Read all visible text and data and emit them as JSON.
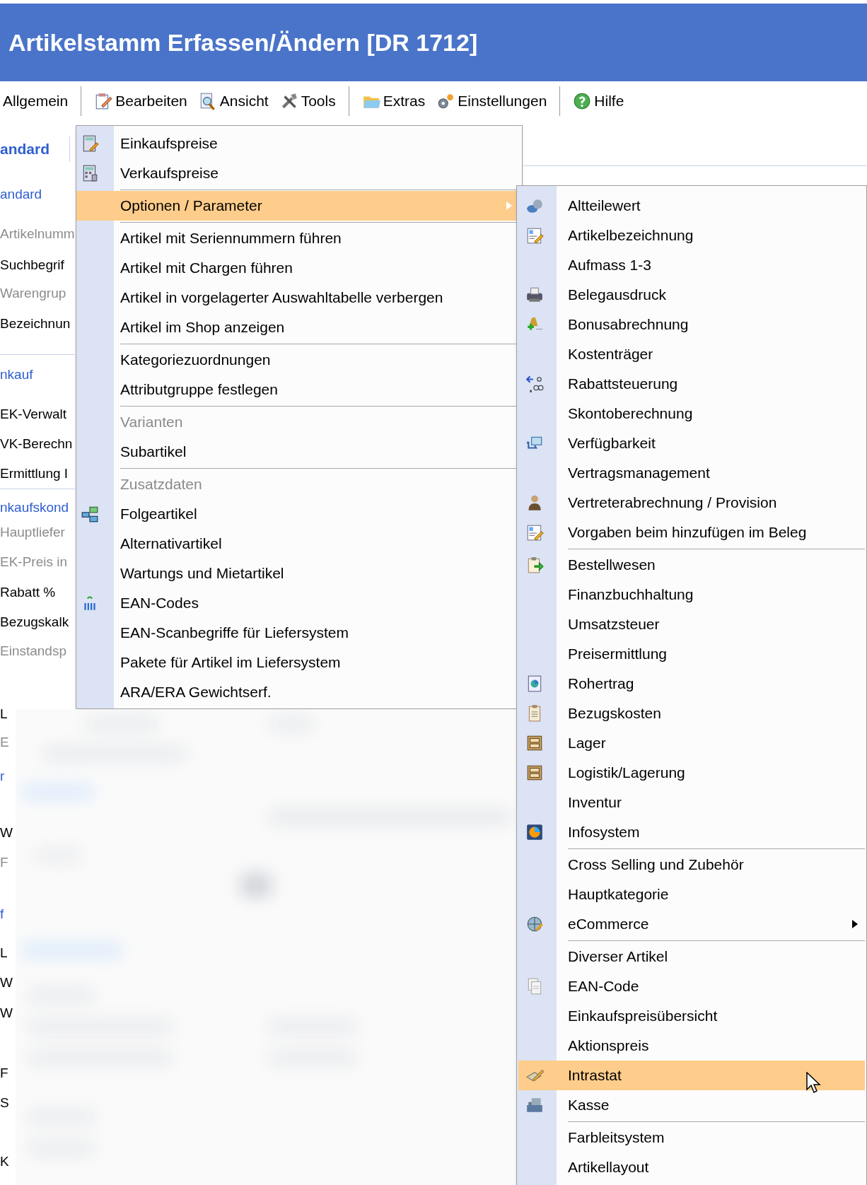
{
  "window": {
    "title": "Artikelstamm Erfassen/Ändern [DR 1712]"
  },
  "toolbar": [
    {
      "kind": "button",
      "label": "Allgemein"
    },
    {
      "kind": "separator"
    },
    {
      "kind": "button",
      "label": "Bearbeiten"
    },
    {
      "kind": "button",
      "label": "Ansicht"
    },
    {
      "kind": "button",
      "label": "Tools"
    },
    {
      "kind": "separator"
    },
    {
      "kind": "button",
      "label": "Extras"
    },
    {
      "kind": "button",
      "label": "Einstellungen"
    },
    {
      "kind": "separator"
    },
    {
      "kind": "button",
      "label": "Hilfe"
    }
  ],
  "form_fragments": [
    {
      "kind": "tab",
      "text": "andard"
    },
    {
      "kind": "section",
      "text": "andard"
    },
    {
      "kind": "disabled",
      "text": "Artikelnumm"
    },
    {
      "kind": "label",
      "text": "Suchbegrif"
    },
    {
      "kind": "disabled",
      "text": "Warengrup"
    },
    {
      "kind": "label",
      "text": "Bezeichnun"
    },
    {
      "kind": "section",
      "text": "nkauf"
    },
    {
      "kind": "label",
      "text": "EK-Verwalt"
    },
    {
      "kind": "label",
      "text": "VK-Berechn"
    },
    {
      "kind": "label",
      "text": "Ermittlung I"
    },
    {
      "kind": "section",
      "text": "nkaufskond"
    },
    {
      "kind": "disabled",
      "text": "Hauptliefer"
    },
    {
      "kind": "disabled",
      "text": "EK-Preis in"
    },
    {
      "kind": "label",
      "text": "Rabatt %"
    },
    {
      "kind": "label",
      "text": "Bezugskalk"
    },
    {
      "kind": "disabled",
      "text": "Einstandsp"
    }
  ],
  "lower_fragments": [
    {
      "kind": "label",
      "text": "L"
    },
    {
      "kind": "disabled",
      "text": "E"
    },
    {
      "kind": "section",
      "text": "r"
    },
    {
      "kind": "label",
      "text": "W"
    },
    {
      "kind": "disabled",
      "text": "F"
    },
    {
      "kind": "section",
      "text": "f"
    },
    {
      "kind": "label",
      "text": "L"
    },
    {
      "kind": "label",
      "text": "W"
    },
    {
      "kind": "label",
      "text": "W"
    },
    {
      "kind": "label",
      "text": "F"
    },
    {
      "kind": "label",
      "text": "S"
    },
    {
      "kind": "label",
      "text": "K"
    }
  ],
  "menu": [
    {
      "kind": "item",
      "label": "Einkaufspreise",
      "disabled": false,
      "selected": false
    },
    {
      "kind": "item",
      "label": "Verkaufspreise",
      "disabled": false,
      "selected": false
    },
    {
      "kind": "separator"
    },
    {
      "kind": "submenu",
      "label": "Optionen / Parameter",
      "disabled": false,
      "selected": true
    },
    {
      "kind": "separator"
    },
    {
      "kind": "item",
      "label": "Artikel mit Seriennummern führen",
      "disabled": false,
      "selected": false
    },
    {
      "kind": "item",
      "label": "Artikel mit Chargen führen",
      "disabled": false,
      "selected": false
    },
    {
      "kind": "item",
      "label": "Artikel in vorgelagerter Auswahltabelle verbergen",
      "disabled": false,
      "selected": false
    },
    {
      "kind": "item",
      "label": "Artikel im Shop anzeigen",
      "disabled": false,
      "selected": false
    },
    {
      "kind": "separator"
    },
    {
      "kind": "item",
      "label": "Kategoriezuordnungen",
      "disabled": false,
      "selected": false
    },
    {
      "kind": "item",
      "label": "Attributgruppe festlegen",
      "disabled": false,
      "selected": false
    },
    {
      "kind": "separator"
    },
    {
      "kind": "item",
      "label": "Varianten",
      "disabled": true,
      "selected": false
    },
    {
      "kind": "item",
      "label": "Subartikel",
      "disabled": false,
      "selected": false
    },
    {
      "kind": "separator"
    },
    {
      "kind": "item",
      "label": "Zusatzdaten",
      "disabled": true,
      "selected": false
    },
    {
      "kind": "item",
      "label": "Folgeartikel",
      "disabled": false,
      "selected": false
    },
    {
      "kind": "item",
      "label": "Alternativartikel",
      "disabled": false,
      "selected": false
    },
    {
      "kind": "item",
      "label": "Wartungs und Mietartikel",
      "disabled": false,
      "selected": false
    },
    {
      "kind": "item",
      "label": "EAN-Codes",
      "disabled": false,
      "selected": false
    },
    {
      "kind": "item",
      "label": "EAN-Scanbegriffe für Liefersystem",
      "disabled": false,
      "selected": false
    },
    {
      "kind": "item",
      "label": "Pakete für Artikel im Liefersystem",
      "disabled": false,
      "selected": false
    },
    {
      "kind": "item",
      "label": "ARA/ERA Gewichtserf.",
      "disabled": false,
      "selected": false
    }
  ],
  "submenu": [
    {
      "kind": "item",
      "label": "Altteilewert",
      "selected": false
    },
    {
      "kind": "item",
      "label": "Artikelbezeichnung",
      "selected": false
    },
    {
      "kind": "item",
      "label": "Aufmass 1-3",
      "selected": false
    },
    {
      "kind": "item",
      "label": "Belegausdruck",
      "selected": false
    },
    {
      "kind": "item",
      "label": "Bonusabrechnung",
      "selected": false
    },
    {
      "kind": "item",
      "label": "Kostenträger",
      "selected": false
    },
    {
      "kind": "item",
      "label": "Rabattsteuerung",
      "selected": false
    },
    {
      "kind": "item",
      "label": "Skontoberechnung",
      "selected": false
    },
    {
      "kind": "item",
      "label": "Verfügbarkeit",
      "selected": false
    },
    {
      "kind": "item",
      "label": "Vertragsmanagement",
      "selected": false
    },
    {
      "kind": "item",
      "label": "Vertreterabrechnung / Provision",
      "selected": false
    },
    {
      "kind": "item",
      "label": "Vorgaben beim hinzufügen im Beleg",
      "selected": false
    },
    {
      "kind": "separator"
    },
    {
      "kind": "item",
      "label": "Bestellwesen",
      "selected": false
    },
    {
      "kind": "item",
      "label": "Finanzbuchhaltung",
      "selected": false
    },
    {
      "kind": "item",
      "label": "Umsatzsteuer",
      "selected": false
    },
    {
      "kind": "item",
      "label": "Preisermittlung",
      "selected": false
    },
    {
      "kind": "item",
      "label": "Rohertrag",
      "selected": false
    },
    {
      "kind": "item",
      "label": "Bezugskosten",
      "selected": false
    },
    {
      "kind": "item",
      "label": "Lager",
      "selected": false
    },
    {
      "kind": "item",
      "label": "Logistik/Lagerung",
      "selected": false
    },
    {
      "kind": "item",
      "label": "Inventur",
      "selected": false
    },
    {
      "kind": "item",
      "label": "Infosystem",
      "selected": false
    },
    {
      "kind": "separator"
    },
    {
      "kind": "item",
      "label": "Cross Selling und Zubehör",
      "selected": false
    },
    {
      "kind": "item",
      "label": "Hauptkategorie",
      "selected": false
    },
    {
      "kind": "submenu",
      "label": "eCommerce",
      "selected": false
    },
    {
      "kind": "separator"
    },
    {
      "kind": "item",
      "label": "Diverser Artikel",
      "selected": false
    },
    {
      "kind": "item",
      "label": "EAN-Code",
      "selected": false
    },
    {
      "kind": "item",
      "label": "Einkaufspreisübersicht",
      "selected": false
    },
    {
      "kind": "item",
      "label": "Aktionspreis",
      "selected": false
    },
    {
      "kind": "item",
      "label": "Intrastat",
      "selected": true
    },
    {
      "kind": "item",
      "label": "Kasse",
      "selected": false
    },
    {
      "kind": "separator"
    },
    {
      "kind": "item",
      "label": "Farbleitsystem",
      "selected": false
    },
    {
      "kind": "item",
      "label": "Artikellayout",
      "selected": false
    }
  ]
}
